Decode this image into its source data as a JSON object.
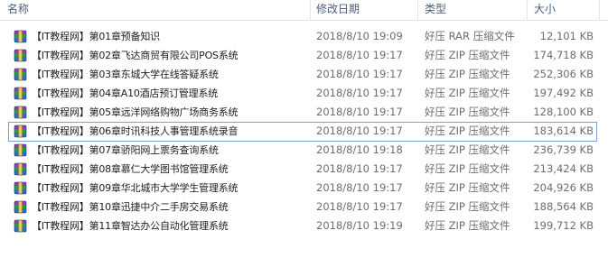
{
  "columns": {
    "name": "名称",
    "date": "修改日期",
    "type": "类型",
    "size": "大小"
  },
  "files": [
    {
      "name": "【IT教程网】第01章预备知识",
      "date": "2018/8/10 19:09",
      "type": "好压 RAR 压缩文件",
      "size": "12,101 KB"
    },
    {
      "name": "【IT教程网】第02章飞达商贸有限公司POS系统",
      "date": "2018/8/10 19:17",
      "type": "好压 ZIP 压缩文件",
      "size": "174,718 KB"
    },
    {
      "name": "【IT教程网】第03章东城大学在线答疑系统",
      "date": "2018/8/10 19:17",
      "type": "好压 ZIP 压缩文件",
      "size": "252,306 KB"
    },
    {
      "name": "【IT教程网】第04章A10酒店预订管理系统",
      "date": "2018/8/10 19:17",
      "type": "好压 ZIP 压缩文件",
      "size": "197,492 KB"
    },
    {
      "name": "【IT教程网】第05章远洋网络购物广场商务系统",
      "date": "2018/8/10 19:17",
      "type": "好压 ZIP 压缩文件",
      "size": "128,100 KB"
    },
    {
      "name": "【IT教程网】第06章时讯科技人事管理系统录音",
      "date": "2018/8/10 19:17",
      "type": "好压 ZIP 压缩文件",
      "size": "183,614 KB"
    },
    {
      "name": "【IT教程网】第07章骄阳网上票务查询系统",
      "date": "2018/8/10 19:18",
      "type": "好压 ZIP 压缩文件",
      "size": "236,739 KB"
    },
    {
      "name": "【IT教程网】第08章慕仁大学图书馆管理系统",
      "date": "2018/8/10 19:17",
      "type": "好压 ZIP 压缩文件",
      "size": "213,424 KB"
    },
    {
      "name": "【IT教程网】第09章华北城市大学学生管理系统",
      "date": "2018/8/10 19:17",
      "type": "好压 ZIP 压缩文件",
      "size": "204,926 KB"
    },
    {
      "name": "【IT教程网】第10章迅捷中介二手房交易系统",
      "date": "2018/8/10 19:17",
      "type": "好压 ZIP 压缩文件",
      "size": "188,564 KB"
    },
    {
      "name": "【IT教程网】第11章智达办公自动化管理系统",
      "date": "2018/8/10 19:19",
      "type": "好压 ZIP 压缩文件",
      "size": "199,712 KB"
    }
  ],
  "focused_index": 5,
  "icon": "archive-file-icon",
  "colors": {
    "header_text": "#4c607a",
    "secondary_text": "#6d6d6d",
    "focus_border": "#7da2ce"
  }
}
